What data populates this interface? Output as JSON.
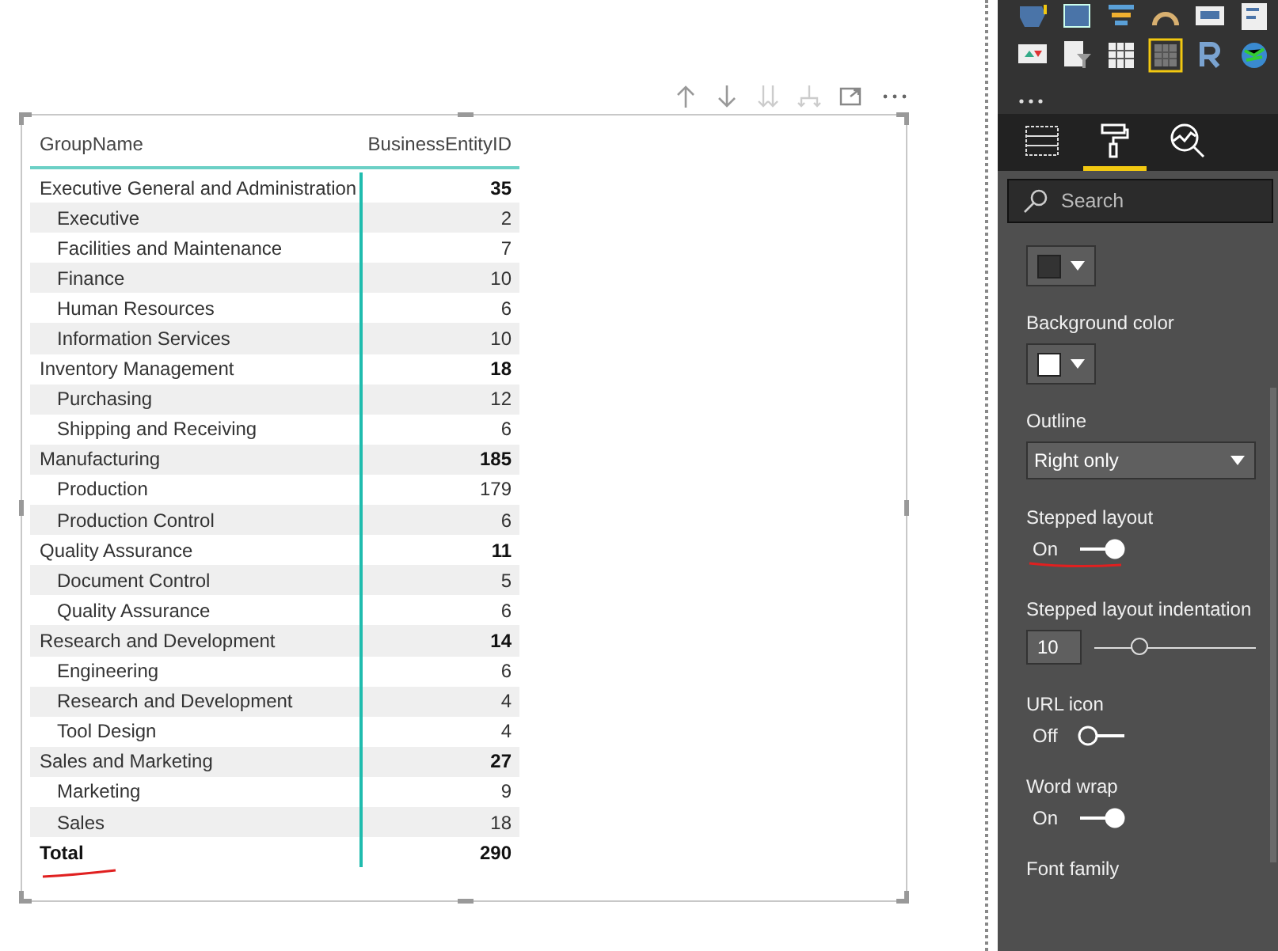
{
  "table": {
    "columns": [
      "GroupName",
      "BusinessEntityID"
    ],
    "rows": [
      {
        "name": "Executive General and Administration",
        "value": "35",
        "children": [
          {
            "name": "Executive",
            "value": "2"
          },
          {
            "name": "Facilities and Maintenance",
            "value": "7"
          },
          {
            "name": "Finance",
            "value": "10"
          },
          {
            "name": "Human Resources",
            "value": "6"
          },
          {
            "name": "Information Services",
            "value": "10"
          }
        ]
      },
      {
        "name": "Inventory Management",
        "value": "18",
        "children": [
          {
            "name": "Purchasing",
            "value": "12"
          },
          {
            "name": "Shipping and Receiving",
            "value": "6"
          }
        ]
      },
      {
        "name": "Manufacturing",
        "value": "185",
        "children": [
          {
            "name": "Production",
            "value": "179"
          },
          {
            "name": "Production Control",
            "value": "6"
          }
        ]
      },
      {
        "name": "Quality Assurance",
        "value": "11",
        "children": [
          {
            "name": "Document Control",
            "value": "5"
          },
          {
            "name": "Quality Assurance",
            "value": "6"
          }
        ]
      },
      {
        "name": "Research and Development",
        "value": "14",
        "children": [
          {
            "name": "Engineering",
            "value": "6"
          },
          {
            "name": "Research and Development",
            "value": "4"
          },
          {
            "name": "Tool Design",
            "value": "4"
          }
        ]
      },
      {
        "name": "Sales and Marketing",
        "value": "27",
        "children": [
          {
            "name": "Marketing",
            "value": "9"
          },
          {
            "name": "Sales",
            "value": "18"
          }
        ]
      }
    ],
    "total": {
      "name": "Total",
      "value": "290"
    }
  },
  "pane_tabs": [
    {
      "kind": "fields",
      "selected": false
    },
    {
      "kind": "format",
      "selected": true
    },
    {
      "kind": "analytics",
      "selected": false
    }
  ],
  "search": {
    "placeholder": "Search"
  },
  "settings": [
    {
      "kind": "color",
      "color": "#333333"
    },
    {
      "kind": "color",
      "label": "Background color",
      "color": "#ffffff"
    },
    {
      "kind": "dropdown",
      "label": "Outline",
      "value": "Right only"
    },
    {
      "kind": "toggle",
      "label": "Stepped layout",
      "state_text": "On",
      "on": true
    },
    {
      "kind": "slider",
      "label": "Stepped layout indentation",
      "value": "10",
      "level": 0.28
    },
    {
      "kind": "toggle",
      "label": "URL icon",
      "state_text": "Off",
      "on": false
    },
    {
      "kind": "toggle",
      "label": "Word wrap",
      "state_text": "On",
      "on": true
    },
    {
      "kind": "heading",
      "label": "Font family"
    }
  ]
}
